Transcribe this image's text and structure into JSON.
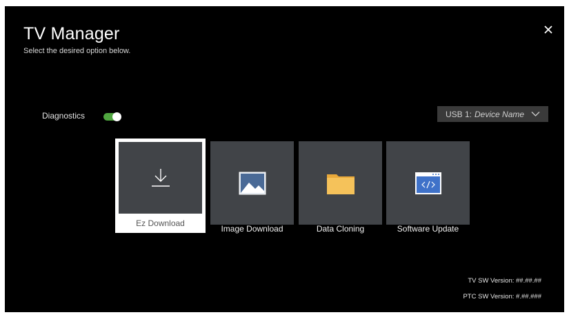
{
  "header": {
    "title": "TV Manager",
    "subtitle": "Select the desired option below."
  },
  "diagnostics": {
    "label": "Diagnostics",
    "enabled": true,
    "toggle_color": "#4fa53f"
  },
  "usb": {
    "prefix": "USB 1:",
    "device": "Device Name",
    "icon": "chevron-down-icon"
  },
  "cards": [
    {
      "label": "Ez Download",
      "icon": "download-icon",
      "focused": true
    },
    {
      "label": "Image Download",
      "icon": "image-icon",
      "focused": false
    },
    {
      "label": "Data Cloning",
      "icon": "folder-icon",
      "focused": false
    },
    {
      "label": "Software Update",
      "icon": "code-window-icon",
      "focused": false
    }
  ],
  "versions": {
    "tv_sw": "TV SW Version: ##.##.##",
    "ptc_sw": "PTC SW Version: #.##.###"
  },
  "colors": {
    "background": "#000000",
    "card": "#414448",
    "focus": "#ffffff",
    "accent_green": "#4fa53f",
    "folder": "#f0b84a"
  }
}
